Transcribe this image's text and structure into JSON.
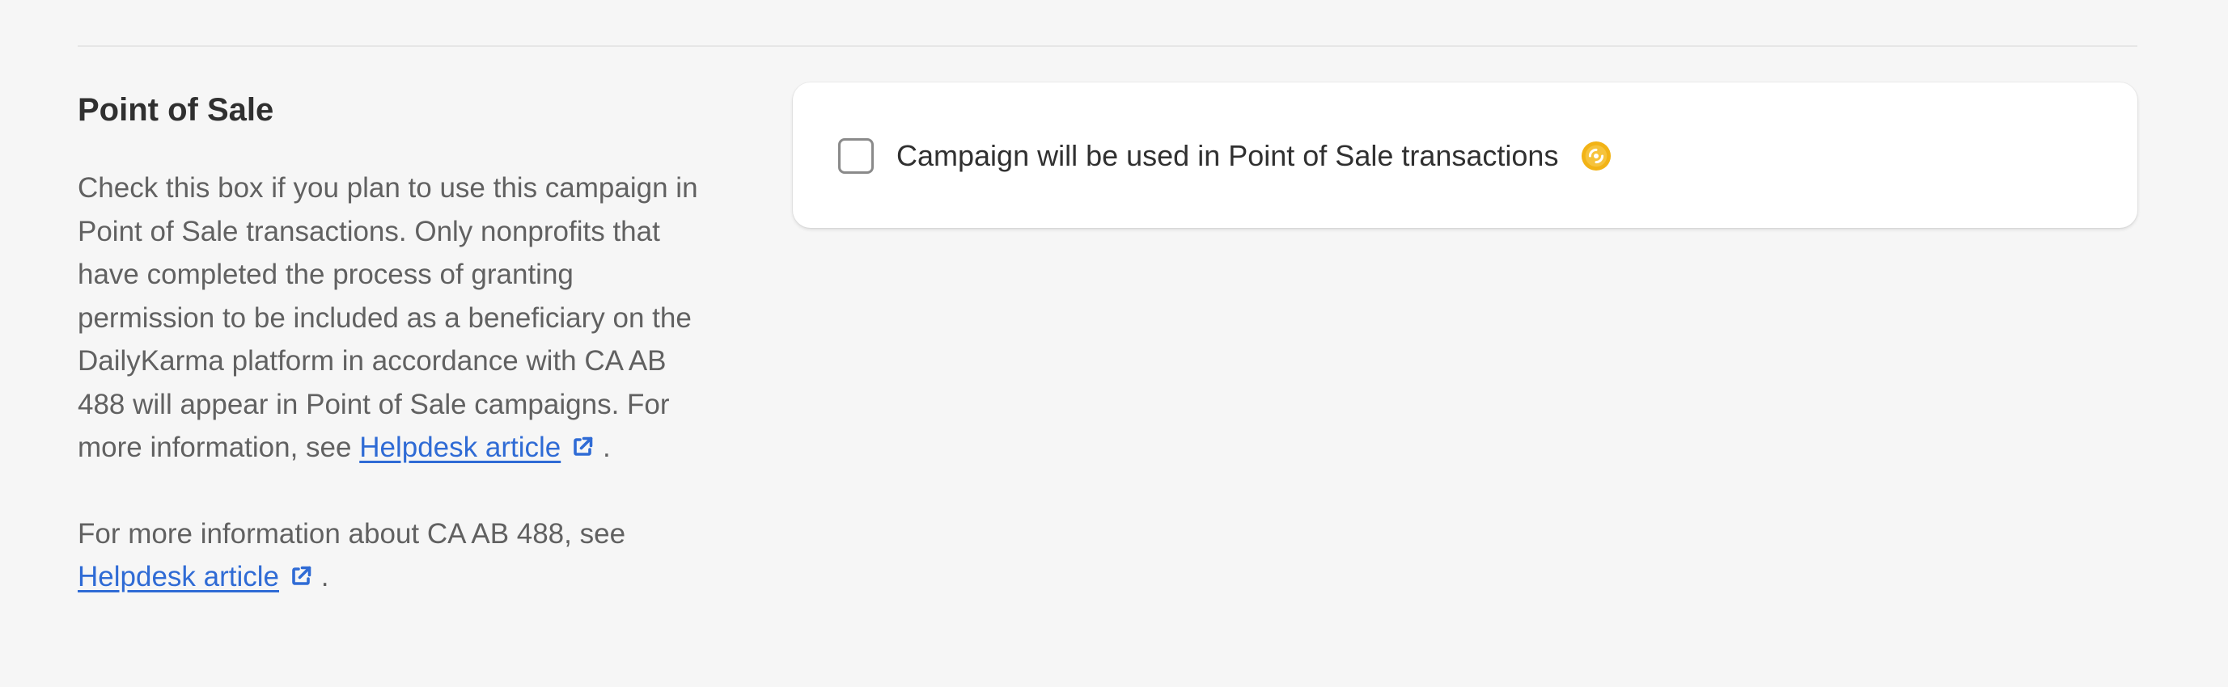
{
  "section": {
    "title": "Point of Sale",
    "description_1_text": "Check this box if you plan to use this campaign in Point of Sale transactions. Only nonprofits that have completed the process of granting permission to be included as a beneficiary on the DailyKarma platform in accordance with CA AB 488 will appear in Point of Sale campaigns. For more information, see ",
    "description_1_link": "Helpdesk article",
    "description_1_end": ".",
    "description_2_text": "For more information about CA AB 488, see ",
    "description_2_link": "Helpdesk article",
    "description_2_end": ".",
    "link_icon": "external-link-icon"
  },
  "card": {
    "checkbox_label": "Campaign will be used in Point of Sale transactions",
    "checkbox_checked": false,
    "badge_icon": "dailykarma-badge-icon"
  },
  "colors": {
    "background": "#f6f6f6",
    "card": "#ffffff",
    "heading": "#303030",
    "body_text": "#616161",
    "link": "#2f6bd5",
    "badge": "#f2b316"
  }
}
